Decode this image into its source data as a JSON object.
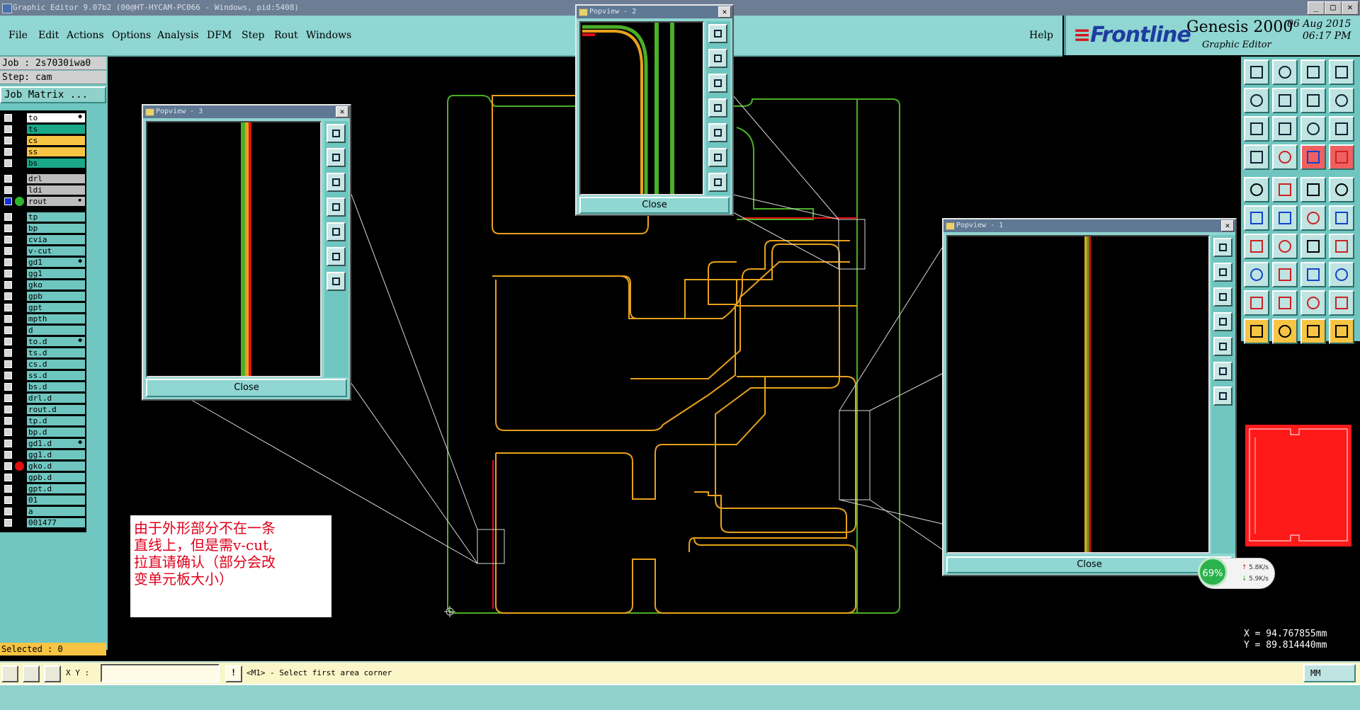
{
  "window": {
    "title": "Graphic Editor 9.07b2 (00@HT-HYCAM-PC066 - Windows, pid:5408)",
    "minimize": "_",
    "maximize": "□",
    "close": "✕"
  },
  "menu": [
    "File",
    "Edit",
    "Actions",
    "Options",
    "Analysis",
    "DFM",
    "Step",
    "Rout",
    "Windows"
  ],
  "help": "Help",
  "brand": {
    "logo": "Frontline",
    "product": "Genesis 2000",
    "subtitle": "Graphic Editor",
    "date": "06 Aug 2015",
    "time": "06:17 PM"
  },
  "job": {
    "job_line": "Job : 2s7030iwa0",
    "step_line": "Step: cam",
    "job_matrix": "Job Matrix ..."
  },
  "layers": [
    {
      "name": "to",
      "color": "#ffffff",
      "marker": "⬥"
    },
    {
      "name": "ts",
      "color": "#1aa88a"
    },
    {
      "name": "cs",
      "color": "#f7c443"
    },
    {
      "name": "ss",
      "color": "#f7c443"
    },
    {
      "name": "bs",
      "color": "#1aa88a"
    },
    {
      "name": "drl",
      "color": "#bdbdbd"
    },
    {
      "name": "ldi",
      "color": "#bdbdbd"
    },
    {
      "name": "rout",
      "color": "#bdbdbd",
      "dot": "#2fb52f",
      "selected": true,
      "marker": "▪"
    },
    {
      "name": "tp",
      "color": "#6fc6c0"
    },
    {
      "name": "bp",
      "color": "#6fc6c0"
    },
    {
      "name": "cvia",
      "color": "#6fc6c0"
    },
    {
      "name": "v-cut",
      "color": "#6fc6c0"
    },
    {
      "name": "gd1",
      "color": "#6fc6c0",
      "marker": "⬥"
    },
    {
      "name": "gg1",
      "color": "#6fc6c0"
    },
    {
      "name": "gko",
      "color": "#6fc6c0"
    },
    {
      "name": "gpb",
      "color": "#6fc6c0"
    },
    {
      "name": "gpt",
      "color": "#6fc6c0"
    },
    {
      "name": "mpth",
      "color": "#6fc6c0"
    },
    {
      "name": "d",
      "color": "#6fc6c0"
    },
    {
      "name": "to.d",
      "color": "#6fc6c0",
      "marker": "⬥"
    },
    {
      "name": "ts.d",
      "color": "#6fc6c0"
    },
    {
      "name": "cs.d",
      "color": "#6fc6c0"
    },
    {
      "name": "ss.d",
      "color": "#6fc6c0"
    },
    {
      "name": "bs.d",
      "color": "#6fc6c0"
    },
    {
      "name": "drl.d",
      "color": "#6fc6c0"
    },
    {
      "name": "rout.d",
      "color": "#6fc6c0"
    },
    {
      "name": "tp.d",
      "color": "#6fc6c0"
    },
    {
      "name": "bp.d",
      "color": "#6fc6c0"
    },
    {
      "name": "gd1.d",
      "color": "#6fc6c0",
      "marker": "⬥"
    },
    {
      "name": "gg1.d",
      "color": "#6fc6c0"
    },
    {
      "name": "gko.d",
      "color": "#6fc6c0",
      "dot": "#e01010"
    },
    {
      "name": "gpb.d",
      "color": "#6fc6c0"
    },
    {
      "name": "gpt.d",
      "color": "#6fc6c0"
    },
    {
      "name": "01",
      "color": "#6fc6c0"
    },
    {
      "name": "a",
      "color": "#6fc6c0"
    },
    {
      "name": "001477",
      "color": "#6fc6c0"
    }
  ],
  "selected_label": "Selected : 0",
  "popups": {
    "p1": {
      "title": "Popview - 1",
      "close_label": "Close"
    },
    "p2": {
      "title": "Popview - 2",
      "close_label": "Close"
    },
    "p3": {
      "title": "Popview - 3",
      "close_label": "Close"
    },
    "close_x": "✕"
  },
  "note": {
    "lines": [
      "由于外形部分不在一条",
      "直线上，但是需v-cut,",
      "拉直请确认（部分会改",
      "变单元板大小）"
    ]
  },
  "network": {
    "percent": "69%",
    "up": "5.8K/s",
    "down": "5.9K/s"
  },
  "coords": {
    "x": "X = 94.767855mm",
    "y": "Y = 89.814440mm"
  },
  "bottom": {
    "xy_label": "X Y :",
    "xy_value": "",
    "status": "<M1> - Select first area corner",
    "unit": "MM"
  },
  "colors": {
    "outline_green": "#4caf27",
    "board_orange": "#e8a11c",
    "rout_red": "#e01010",
    "panel_teal": "#90d6d2"
  }
}
